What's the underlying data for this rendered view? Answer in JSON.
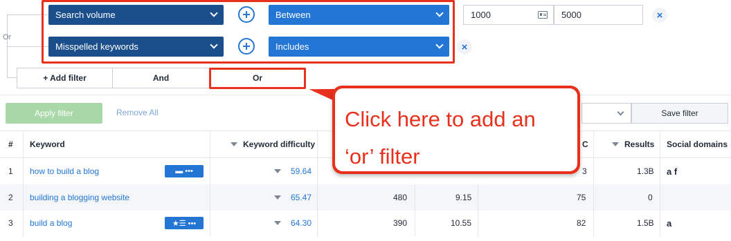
{
  "filters": {
    "row1": {
      "field": "Search volume",
      "operator": "Between",
      "min": "1000",
      "max": "5000"
    },
    "row2": {
      "field": "Misspelled keywords",
      "operator": "Includes"
    },
    "side_label": "Or",
    "buttons": {
      "add_filter": "+ Add filter",
      "and": "And",
      "or": "Or"
    },
    "remove_symbol": "×"
  },
  "actions": {
    "apply": "Apply filter",
    "remove_all": "Remove All",
    "save": "Save filter"
  },
  "table": {
    "columns": {
      "index": "#",
      "keyword": "Keyword",
      "difficulty": "Keyword difficulty",
      "c": "C",
      "results": "Results",
      "social": "Social domains"
    },
    "rows": [
      {
        "n": "1",
        "keyword": "how to build a blog",
        "difficulty": "59.64",
        "volume": "",
        "cpc": "",
        "c": "3",
        "results": "1.3B",
        "social": "a  f"
      },
      {
        "n": "2",
        "keyword": "building a blogging website",
        "difficulty": "65.47",
        "volume": "480",
        "cpc": "9.15",
        "c": "75",
        "results": "0",
        "social": ""
      },
      {
        "n": "3",
        "keyword": "build a blog",
        "difficulty": "64.30",
        "volume": "390",
        "cpc": "10.55",
        "c": "82",
        "results": "1.5B",
        "social": "a"
      }
    ],
    "badges": {
      "row1": "▬  •••",
      "row3": "★☰  •••"
    }
  },
  "callout": {
    "line1": "Click here to add an",
    "line2": "‘or’ filter"
  },
  "colors": {
    "accent": "#2376d4",
    "dark_blue": "#1b4f8c",
    "highlight": "#e8301c",
    "apply_disabled": "#a8d8a8"
  }
}
